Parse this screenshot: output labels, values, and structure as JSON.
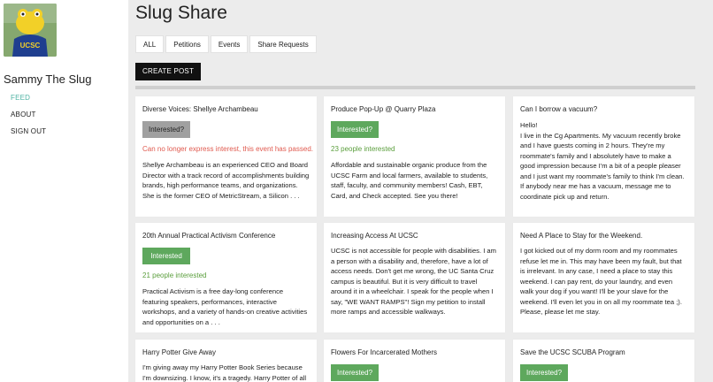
{
  "sidebar": {
    "user_name": "Sammy The Slug",
    "nav": [
      {
        "label": "FEED",
        "active": true
      },
      {
        "label": "ABOUT",
        "active": false
      },
      {
        "label": "SIGN OUT",
        "active": false
      }
    ],
    "avatar_badge": "UCSC"
  },
  "header": {
    "title": "Slug Share",
    "tabs": [
      "ALL",
      "Petitions",
      "Events",
      "Share Requests"
    ],
    "create_button": "CREATE POST"
  },
  "colors": {
    "accent": "#4fb3a3",
    "interested_green": "#5ea85d",
    "disabled_grey": "#a0a0a0",
    "error_red": "#e05a4f",
    "count_green": "#5a9e3c"
  },
  "posts": [
    {
      "title": "Diverse Voices: Shellye Archambeau",
      "button": "Interested?",
      "status": "Can no longer express interest, this event has passed.",
      "description": "Shellye Archambeau is an experienced CEO and Board Director with a track record of accomplishments building brands, high performance teams, and organizations. She is the former CEO of MetricStream, a Silicon . . ."
    },
    {
      "title": "Produce Pop-Up @ Quarry Plaza",
      "button": "Interested?",
      "status": "23 people interested",
      "description": "Affordable and sustainable organic produce from the UCSC Farm and local farmers, available to students, staff, faculty, and community members! Cash, EBT, Card, and Check accepted. See you there!"
    },
    {
      "title": "Can I borrow a vacuum?",
      "description": "Hello!\nI live in the Cg Apartments. My vacuum recently broke and I have guests coming in 2 hours. They're my roommate's family and I absolutely have to make a good impression because I'm a bit of a people pleaser and I just want my roommate's family to think I'm clean. If anybody near me has a vacuum, message me to coordinate pick up and return."
    },
    {
      "title": "20th Annual Practical Activism Conference",
      "button": "Interested",
      "status": "21 people interested",
      "description": "Practical Activism is a free day-long conference featuring speakers, performances, interactive workshops, and a variety of hands-on creative activities and opportunities on a . . ."
    },
    {
      "title": "Increasing Access At UCSC",
      "description": "UCSC is not accessible for people with disabilities. I am a person with a disability and, therefore, have a lot of access needs. Don't get me wrong, the UC Santa Cruz campus is beautiful. But it is very difficult to travel around it in a wheelchair. I speak for the people when I say, \"WE WANT RAMPS\"! Sign my petition to install more ramps and accessible walkways."
    },
    {
      "title": "Need A Place to Stay for the Weekend.",
      "description": "I got kicked out of my dorm room and my roommates refuse let me in. This may have been my fault, but that is irrelevant. In any case, I need a place to stay this weekend. I can pay rent, do your laundry, and even walk your dog if you want! I'll be your slave for the weekend. I'll even let you in on all my roommate tea ;). Please, please let me stay."
    },
    {
      "title": "Harry Potter Give Away",
      "description": "I'm giving away my Harry Potter Book Series because I'm downsizing. I know, it's a tragedy. Harry Potter of all"
    },
    {
      "title": "Flowers For Incarcerated Mothers",
      "button": "Interested?"
    },
    {
      "title": "Save the UCSC SCUBA Program",
      "button": "Interested?"
    }
  ]
}
